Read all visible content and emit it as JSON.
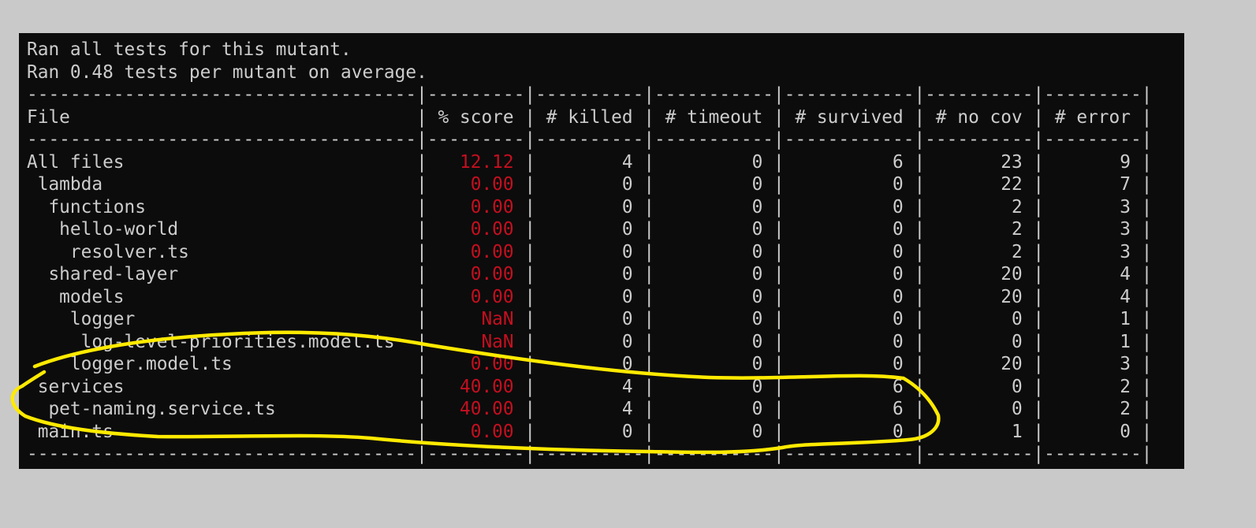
{
  "terminal": {
    "messages": [
      "Ran all tests for this mutant.",
      "Ran 0.48 tests per mutant on average."
    ],
    "separator": "------------------------------------|---------|----------|-----------|------------|----------|---------|",
    "header": "File                                | % score | # killed | # timeout | # survived | # no cov | # error |",
    "rows": [
      {
        "pre": "All files                           |   ",
        "score": "12.12",
        "post": " |        4 |         0 |          6 |       23 |       9 |"
      },
      {
        "pre": " lambda                             |    ",
        "score": "0.00",
        "post": " |        0 |         0 |          0 |       22 |       7 |"
      },
      {
        "pre": "  functions                         |    ",
        "score": "0.00",
        "post": " |        0 |         0 |          0 |        2 |       3 |"
      },
      {
        "pre": "   hello-world                      |    ",
        "score": "0.00",
        "post": " |        0 |         0 |          0 |        2 |       3 |"
      },
      {
        "pre": "    resolver.ts                     |    ",
        "score": "0.00",
        "post": " |        0 |         0 |          0 |        2 |       3 |"
      },
      {
        "pre": "  shared-layer                      |    ",
        "score": "0.00",
        "post": " |        0 |         0 |          0 |       20 |       4 |"
      },
      {
        "pre": "   models                           |    ",
        "score": "0.00",
        "post": " |        0 |         0 |          0 |       20 |       4 |"
      },
      {
        "pre": "    logger                          |     ",
        "score": "NaN",
        "post": " |        0 |         0 |          0 |        0 |       1 |"
      },
      {
        "pre": "     log-level-priorities.model.ts  |     ",
        "score": "NaN",
        "post": " |        0 |         0 |          0 |        0 |       1 |"
      },
      {
        "pre": "    logger.model.ts                 |    ",
        "score": "0.00",
        "post": " |        0 |         0 |          0 |       20 |       3 |"
      },
      {
        "pre": " services                           |   ",
        "score": "40.00",
        "post": " |        4 |         0 |          6 |        0 |       2 |"
      },
      {
        "pre": "  pet-naming.service.ts             |   ",
        "score": "40.00",
        "post": " |        4 |         0 |          6 |        0 |       2 |"
      },
      {
        "pre": " main.ts                            |    ",
        "score": "0.00",
        "post": " |        0 |         0 |          0 |        1 |       0 |"
      }
    ]
  },
  "colors": {
    "score_text": "#c50f1f",
    "annotation_stroke": "#ffea00"
  }
}
